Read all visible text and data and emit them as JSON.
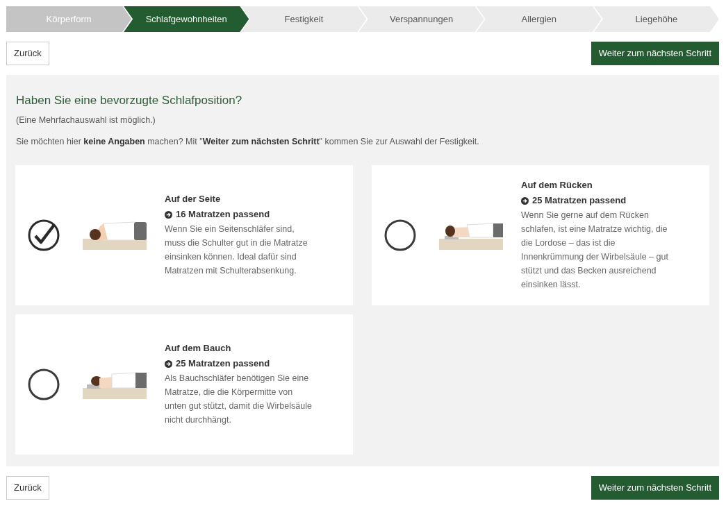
{
  "steps": [
    {
      "label": "Körperform",
      "done": true,
      "selected": false
    },
    {
      "label": "Schlafgewohnheiten",
      "done": false,
      "selected": true
    },
    {
      "label": "Festigkeit",
      "done": false,
      "selected": false
    },
    {
      "label": "Verspannungen",
      "done": false,
      "selected": false
    },
    {
      "label": "Allergien",
      "done": false,
      "selected": false
    },
    {
      "label": "Liegehöhe",
      "done": false,
      "selected": false
    }
  ],
  "top_nav": {
    "back": "Zurück",
    "next": "Weiter zum nächsten Schritt"
  },
  "question": {
    "title": "Haben Sie eine bevorzugte Schlafposition?",
    "hint": "(Eine Mehrfachauswahl ist möglich.)",
    "note": "Sie möchten hier **keine Angaben** machen? Mit \"**Weiter zum nächsten Schritt**\" kommen Sie zur Auswahl der Festigkeit."
  },
  "options": [
    {
      "kind": "side",
      "selected": true,
      "title": "Auf der Seite",
      "count": "16 Matratzen passend",
      "text": "Wenn Sie ein Seitenschläfer sind, muss die Schulter gut in die Matratze einsinken können. Ideal dafür sind Matratzen mit Schulterabsenkung."
    },
    {
      "kind": "back",
      "selected": false,
      "title": "Auf dem Rücken",
      "count": "25 Matratzen passend",
      "text": "Wenn Sie gerne auf dem Rücken schlafen, ist eine Matratze wichtig, die die Lordose – das ist die Innenkrümmung der Wirbelsäule – gut stützt und das Becken ausreichend einsinken lässt."
    },
    {
      "kind": "belly",
      "selected": false,
      "title": "Auf dem Bauch",
      "count": "25 Matratzen passend",
      "text": "Als Bauchschläfer benötigen Sie eine Matratze, die die Körpermitte von unten gut stützt, damit die Wirbelsäule nicht durchhängt."
    }
  ],
  "bottom_nav": {
    "back": "Zurück",
    "next": "Weiter zum nächsten Schritt"
  }
}
